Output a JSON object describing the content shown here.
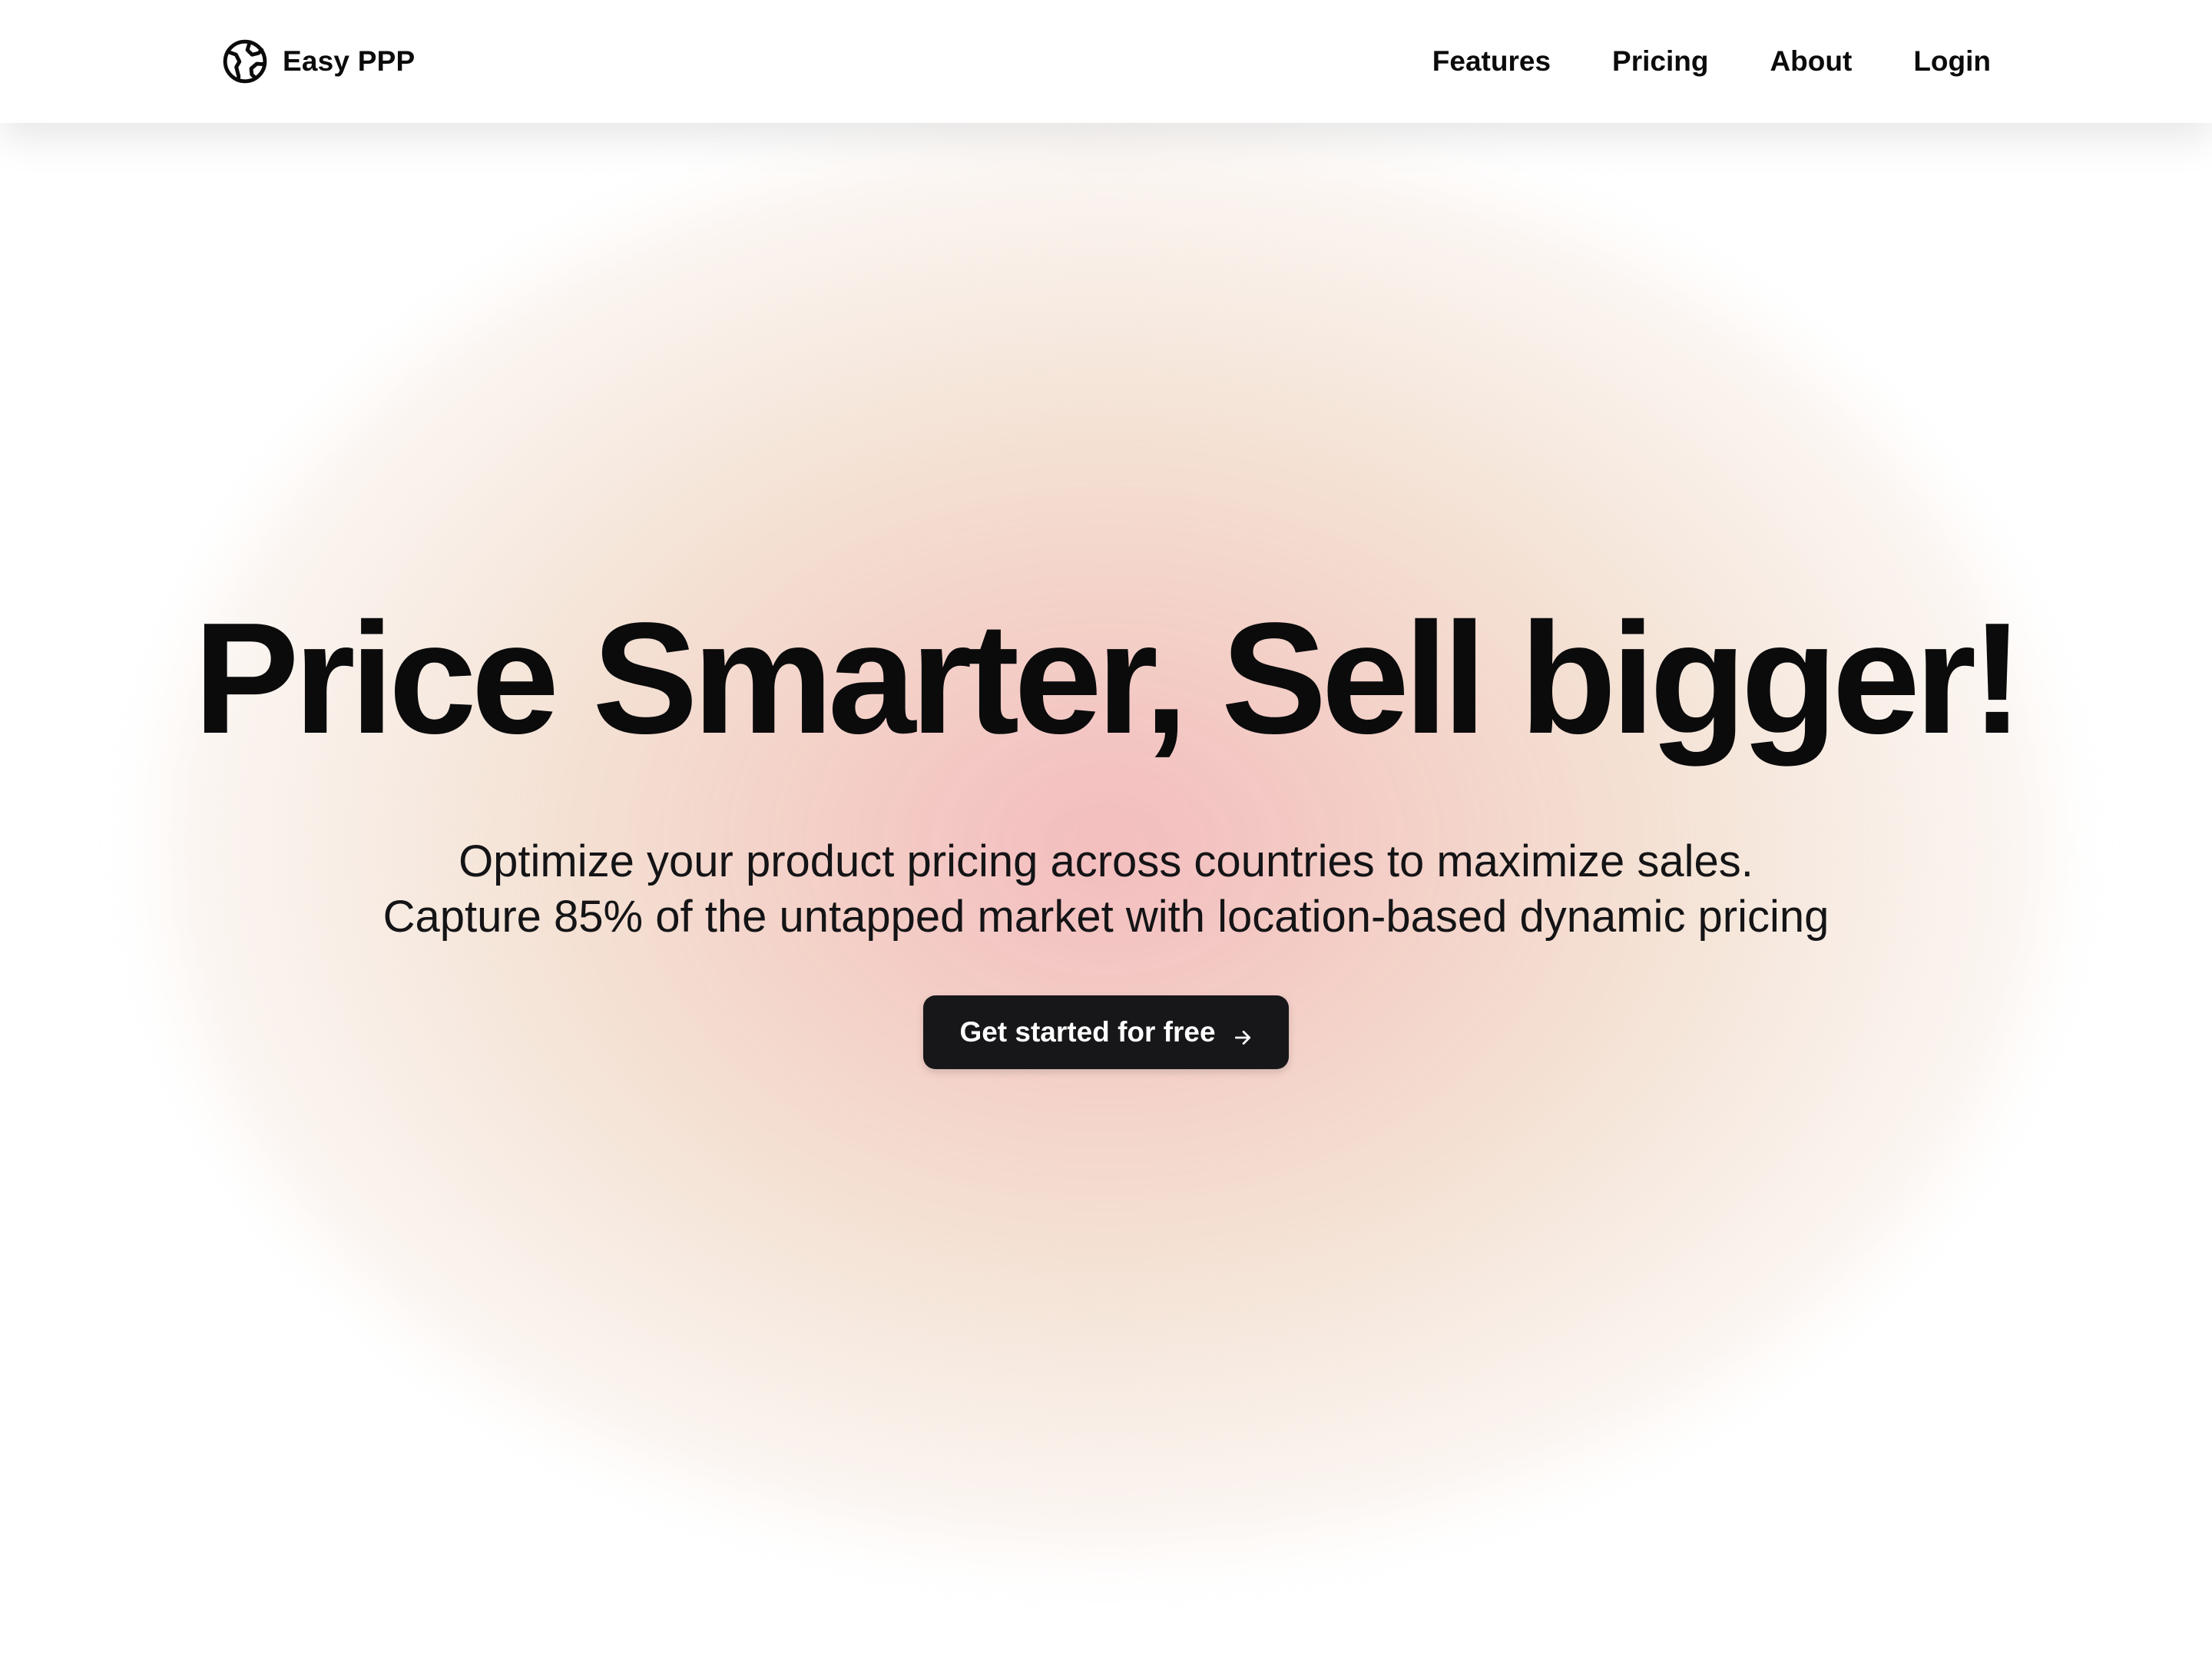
{
  "colors": {
    "text": "#0b0b0c",
    "button_bg": "#17171a",
    "button_text": "#ffffff",
    "glow_center": "#f3bcbe",
    "glow_outer": "#f2ddcd",
    "background": "#ffffff"
  },
  "navbar": {
    "brand": {
      "name": "Easy PPP",
      "icon": "globe-icon"
    },
    "links": [
      {
        "label": "Features"
      },
      {
        "label": "Pricing"
      },
      {
        "label": "About"
      },
      {
        "label": "Login"
      }
    ]
  },
  "hero": {
    "title": "Price Smarter, Sell bigger!",
    "subtitle_lines": [
      "Optimize your product pricing across countries to maximize sales.",
      "Capture 85% of the untapped market with location-based dynamic pricing"
    ],
    "cta": {
      "label": "Get started for free",
      "icon": "arrow-right-icon"
    }
  }
}
